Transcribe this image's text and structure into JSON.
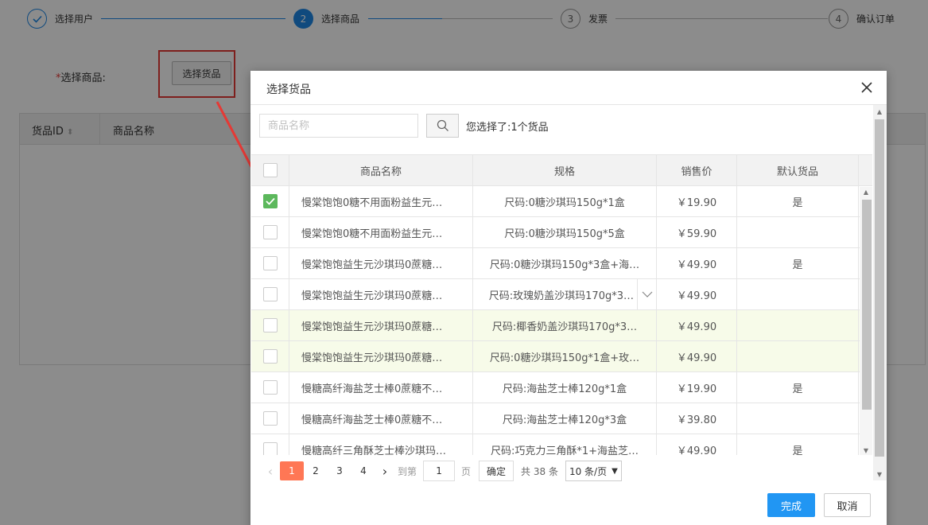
{
  "steps": [
    {
      "num": "",
      "label": "选择用户",
      "state": "done"
    },
    {
      "num": "2",
      "label": "选择商品",
      "state": "active"
    },
    {
      "num": "3",
      "label": "发票",
      "state": "todo"
    },
    {
      "num": "4",
      "label": "确认订单",
      "state": "todo"
    }
  ],
  "form": {
    "required_mark": "*",
    "label": "选择商品:",
    "pick_button": "选择货品"
  },
  "bg_table": {
    "col_id": "货品ID",
    "col_name": "商品名称"
  },
  "modal": {
    "title": "选择货品",
    "search_placeholder": "商品名称",
    "search_value": "",
    "selected_info": "您选择了:1个货品",
    "columns": [
      "商品名称",
      "规格",
      "销售价",
      "默认货品"
    ],
    "rows": [
      {
        "checked": true,
        "name": "慢棠饱饱0糖不用面粉益生元…",
        "spec": "尺码:0糖沙琪玛150g*1盒",
        "price": "￥19.90",
        "default": "是",
        "highlight": false,
        "expand": false
      },
      {
        "checked": false,
        "name": "慢棠饱饱0糖不用面粉益生元…",
        "spec": "尺码:0糖沙琪玛150g*5盒",
        "price": "￥59.90",
        "default": "",
        "highlight": false,
        "expand": false
      },
      {
        "checked": false,
        "name": "慢棠饱饱益生元沙琪玛0蔗糖…",
        "spec": "尺码:0糖沙琪玛150g*3盒+海…",
        "price": "￥49.90",
        "default": "是",
        "highlight": false,
        "expand": false
      },
      {
        "checked": false,
        "name": "慢棠饱饱益生元沙琪玛0蔗糖…",
        "spec": "尺码:玫瑰奶盖沙琪玛170g*3…",
        "price": "￥49.90",
        "default": "",
        "highlight": false,
        "expand": true
      },
      {
        "checked": false,
        "name": "慢棠饱饱益生元沙琪玛0蔗糖…",
        "spec": "尺码:椰香奶盖沙琪玛170g*3…",
        "price": "￥49.90",
        "default": "",
        "highlight": true,
        "expand": false
      },
      {
        "checked": false,
        "name": "慢棠饱饱益生元沙琪玛0蔗糖…",
        "spec": "尺码:0糖沙琪玛150g*1盒+玫…",
        "price": "￥49.90",
        "default": "",
        "highlight": true,
        "expand": false
      },
      {
        "checked": false,
        "name": "慢糖高纤海盐芝士棒0蔗糖不…",
        "spec": "尺码:海盐芝士棒120g*1盒",
        "price": "￥19.90",
        "default": "是",
        "highlight": false,
        "expand": false
      },
      {
        "checked": false,
        "name": "慢糖高纤海盐芝士棒0蔗糖不…",
        "spec": "尺码:海盐芝士棒120g*3盒",
        "price": "￥39.80",
        "default": "",
        "highlight": false,
        "expand": false
      },
      {
        "checked": false,
        "name": "慢糖高纤三角酥芝士棒沙琪玛…",
        "spec": "尺码:巧克力三角酥*1+海盐芝…",
        "price": "￥49.90",
        "default": "是",
        "highlight": false,
        "expand": false
      }
    ],
    "pager": {
      "pages": [
        "1",
        "2",
        "3",
        "4"
      ],
      "current": "1",
      "goto_label": "到第",
      "goto_value": "1",
      "page_unit": "页",
      "confirm": "确定",
      "total": "共 38 条",
      "page_size": "10 条/页"
    },
    "done_button": "完成",
    "cancel_button": "取消"
  },
  "colors": {
    "primary": "#2196f3",
    "step_blue": "#1e88e5",
    "checked_green": "#5cb85c",
    "active_page": "#ff7755",
    "highlight_red": "#e53935"
  }
}
